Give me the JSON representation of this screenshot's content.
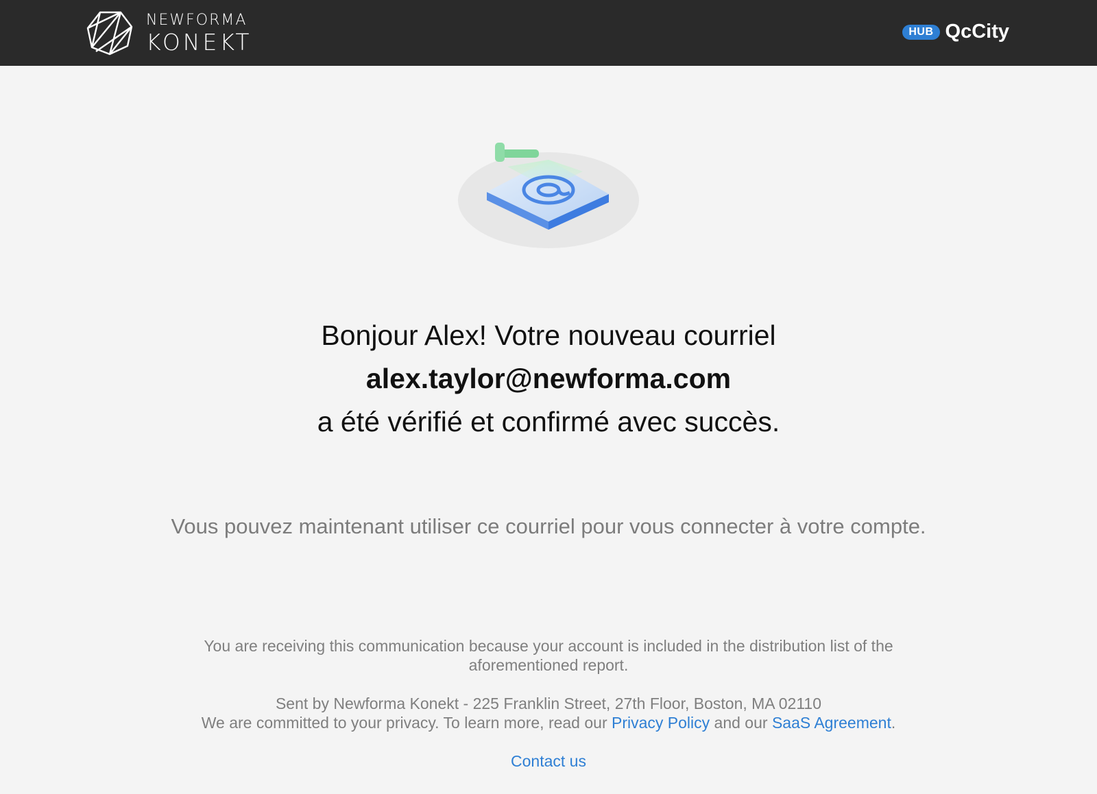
{
  "header": {
    "logo_line1": "NEWFORMA",
    "logo_line2": "KONEKT",
    "hub_badge": "HUB",
    "hub_name": "QcCity"
  },
  "illustration": {
    "icon": "email-verified-icon",
    "accent_green": "#6dd08a",
    "accent_blue": "#4a8de8"
  },
  "message": {
    "line1": "Bonjour Alex! Votre nouveau courriel",
    "email": "alex.taylor@newforma.com",
    "line3": "a été vérifié et confirmé avec succès."
  },
  "subtext": "Vous pouvez maintenant utiliser ce courriel pour vous connecter à votre compte.",
  "footer": {
    "notice": "You are receiving this communication because your account is included in the distribution list of the aforementioned report.",
    "sent_by": "Sent by Newforma Konekt - 225 Franklin Street, 27th Floor, Boston, MA 02110",
    "privacy_prefix": "We are committed to your privacy. To learn more, read our",
    "privacy_link": "Privacy Policy",
    "and_our": "and our",
    "saas_link": "SaaS Agreement",
    "period": ".",
    "contact": "Contact us"
  },
  "colors": {
    "header_bg": "#2a2a2a",
    "page_bg": "#f4f4f4",
    "link": "#2e7fd4"
  }
}
